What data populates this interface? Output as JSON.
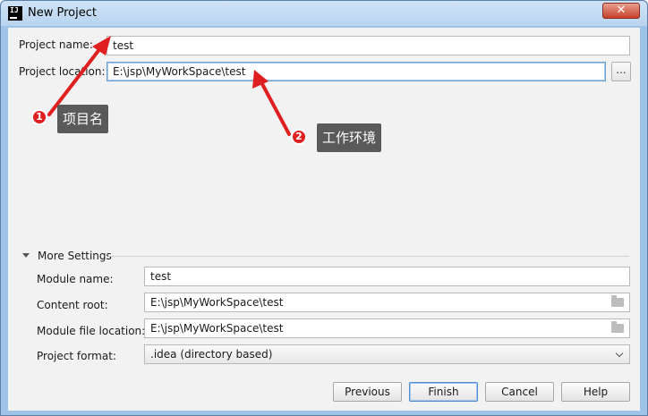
{
  "window": {
    "title": "New Project",
    "close_label": "✕"
  },
  "form": {
    "project_name_label": "Project name:",
    "project_name_value": "test",
    "project_location_label": "Project location:",
    "project_location_value": "E:\\jsp\\MyWorkSpace\\test",
    "browse_label": "..."
  },
  "more_settings": {
    "label": "More Settings",
    "module_name_label": "Module name:",
    "module_name_value": "test",
    "content_root_label": "Content root:",
    "content_root_value": "E:\\jsp\\MyWorkSpace\\test",
    "module_file_location_label": "Module file location:",
    "module_file_location_value": "E:\\jsp\\MyWorkSpace\\test",
    "project_format_label": "Project format:",
    "project_format_value": ".idea (directory based)"
  },
  "buttons": {
    "previous": "Previous",
    "finish": "Finish",
    "cancel": "Cancel",
    "help": "Help"
  },
  "annotations": {
    "badge1": "1",
    "tag1": "项目名",
    "badge2": "2",
    "tag2": "工作环境",
    "color": "#e02020"
  }
}
